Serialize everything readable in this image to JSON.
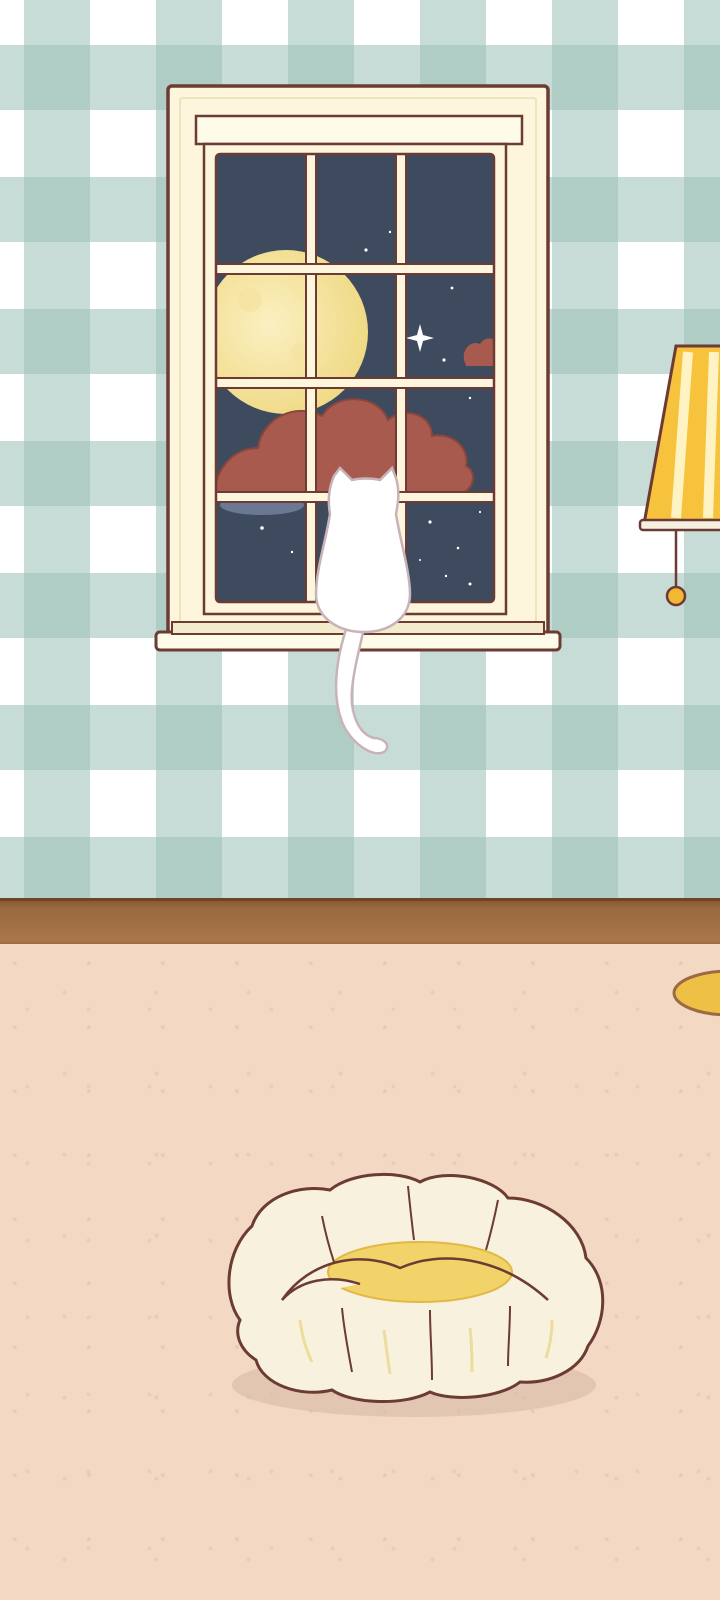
{
  "scene": {
    "name": "night-window-room",
    "time_of_day": "night",
    "colors": {
      "wallpaper_check": "#9bc0b6",
      "wallpaper_base": "#ffffff",
      "floor": "#f3d9c3",
      "baseboard": "#9a6a40",
      "window_frame": "#fdf6dc",
      "outline": "#6b3b34",
      "night_sky": "#3e4a5e",
      "moon": "#f6e7a8",
      "cloud": "#a85a4e",
      "cat": "#ffffff",
      "lamp_shade": "#f7c33c",
      "cushion": "#f8f1dd",
      "cushion_center": "#f2d36a"
    },
    "objects": [
      "window",
      "cat",
      "floor-lamp",
      "cat-bed-cushion",
      "yellow-rug"
    ],
    "icons": [
      "moon-icon",
      "cloud-icon",
      "sparkle-star-icon",
      "cat-icon",
      "lamp-icon",
      "cushion-icon"
    ]
  }
}
